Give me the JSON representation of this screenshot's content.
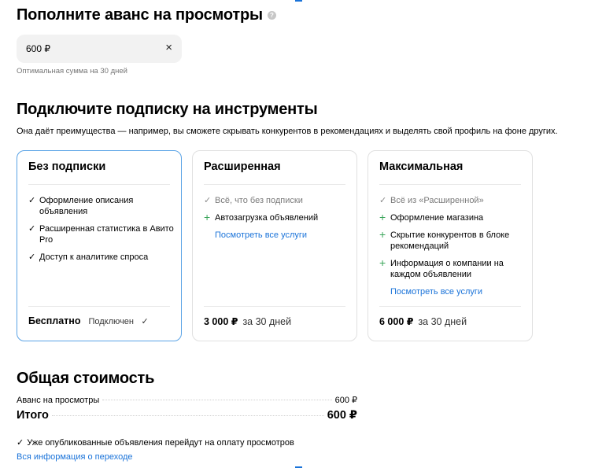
{
  "advance": {
    "title": "Пополните аванс на просмотры",
    "help_icon": "?",
    "value": "600 ₽",
    "clear_icon": "×",
    "hint": "Оптимальная сумма на 30 дней"
  },
  "subscription": {
    "title": "Подключите подписку на инструменты",
    "description": "Она даёт преимущества — например, вы сможете скрывать конкурентов в рекомендациях и выделять свой профиль на фоне других.",
    "plans": [
      {
        "title": "Без подписки",
        "features": [
          "Оформление описания объявления",
          "Расширенная статистика в Авито Pro",
          "Доступ к аналитике спроса"
        ],
        "price": "Бесплатно",
        "status": "Подключен",
        "status_icon": "✓"
      },
      {
        "title": "Расширенная",
        "features": [
          "Всё, что без подписки",
          "Автозагрузка объявлений"
        ],
        "link": "Посмотреть все услуги",
        "price": "3 000 ₽",
        "period": "за 30 дней"
      },
      {
        "title": "Максимальная",
        "features": [
          "Всё из «Расширенной»",
          "Оформление магазина",
          "Скрытие конкурентов в блоке рекомендаций",
          "Информация о компании на каждом объявлении"
        ],
        "link": "Посмотреть все услуги",
        "price": "6 000 ₽",
        "period": "за 30 дней"
      }
    ]
  },
  "total": {
    "title": "Общая стоимость",
    "advance_label": "Аванс на просмотры",
    "advance_value": "600 ₽",
    "total_label": "Итого",
    "total_value": "600 ₽",
    "note": "Уже опубликованные объявления перейдут на оплату просмотров",
    "link": "Вся информация о переходе"
  },
  "colors": {
    "accent_link": "#1a73d9",
    "selected_border": "#5aa3e6",
    "plus_green": "#3aa55a"
  }
}
